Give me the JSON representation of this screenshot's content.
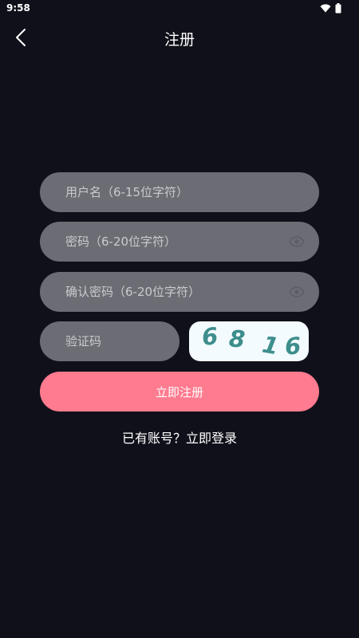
{
  "status_bar": {
    "time": "9:58",
    "wifi_icon": "wifi-icon",
    "battery_icon": "battery-icon"
  },
  "header": {
    "back_icon": "chevron-left-icon",
    "title": "注册"
  },
  "form": {
    "username": {
      "placeholder": "用户名（6-15位字符）",
      "value": ""
    },
    "password": {
      "placeholder": "密码（6-20位字符）",
      "value": "",
      "visibility_icon": "eye-icon"
    },
    "confirm_password": {
      "placeholder": "确认密码（6-20位字符）",
      "value": "",
      "visibility_icon": "eye-icon"
    },
    "captcha": {
      "placeholder": "验证码",
      "value": ""
    },
    "captcha_image": {
      "digits": [
        "6",
        "8",
        "1",
        "6"
      ],
      "color": "#3d8e8c"
    },
    "submit_label": "立即注册"
  },
  "footer": {
    "login_link": "已有账号？立即登录"
  },
  "colors": {
    "background": "#10101a",
    "field": "#6c6c74",
    "primary": "#ff7b8f"
  }
}
